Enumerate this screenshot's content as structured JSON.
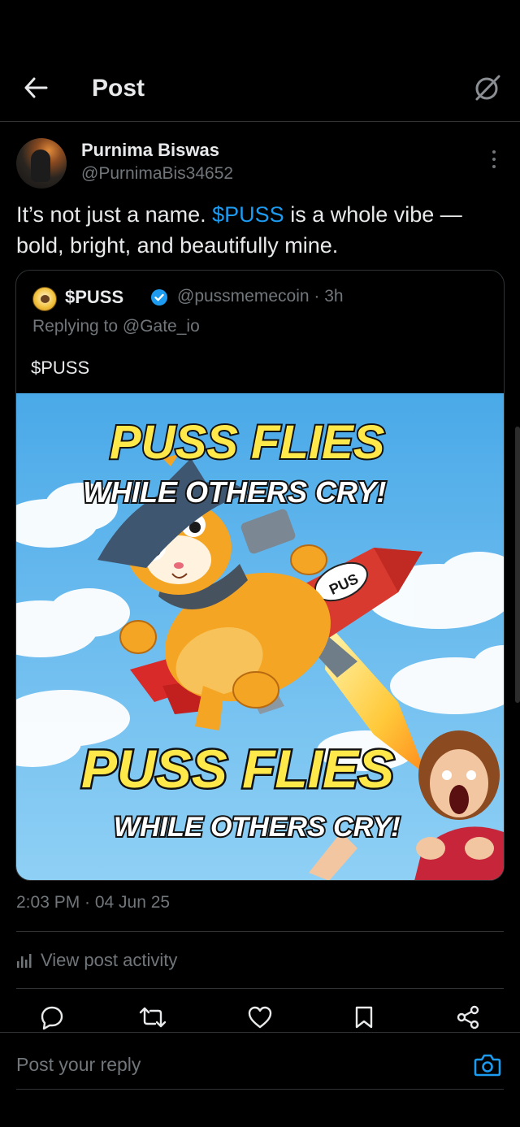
{
  "header": {
    "title": "Post",
    "back_icon": "arrow-left-icon",
    "grok_icon": "grok-slash-icon"
  },
  "author": {
    "name": "Purnima Biswas",
    "handle": "@PurnimaBis34652"
  },
  "post": {
    "text_before": "It’s not just a name. ",
    "cashtag": "$PUSS",
    "text_after": " is a whole vibe —bold, bright, and beautifully mine."
  },
  "quote": {
    "name": "$PUSS",
    "handle_time": "@pussmemecoin · 3h",
    "replying": "Replying to @Gate_io",
    "text": "$PUSS",
    "image": {
      "headline_top_1": "PUSS FLIES",
      "headline_top_2": "WHILE OTHERS CRY!",
      "rocket_label": "PUS",
      "headline_bottom_1": "PUSS FLIES",
      "headline_bottom_2": "WHILE OTHERS CRY!"
    }
  },
  "meta": {
    "timestamp": "2:03 PM · 04 Jun 25",
    "activity": "View post activity"
  },
  "actions": [
    "reply-icon",
    "repost-icon",
    "like-icon",
    "bookmark-icon",
    "share-icon"
  ],
  "reply_bar": {
    "placeholder": "Post your reply"
  },
  "colors": {
    "accent": "#1d9bf0",
    "muted": "#71767b",
    "text": "#e7e9ea",
    "border": "#2f3336",
    "background": "#000000"
  }
}
